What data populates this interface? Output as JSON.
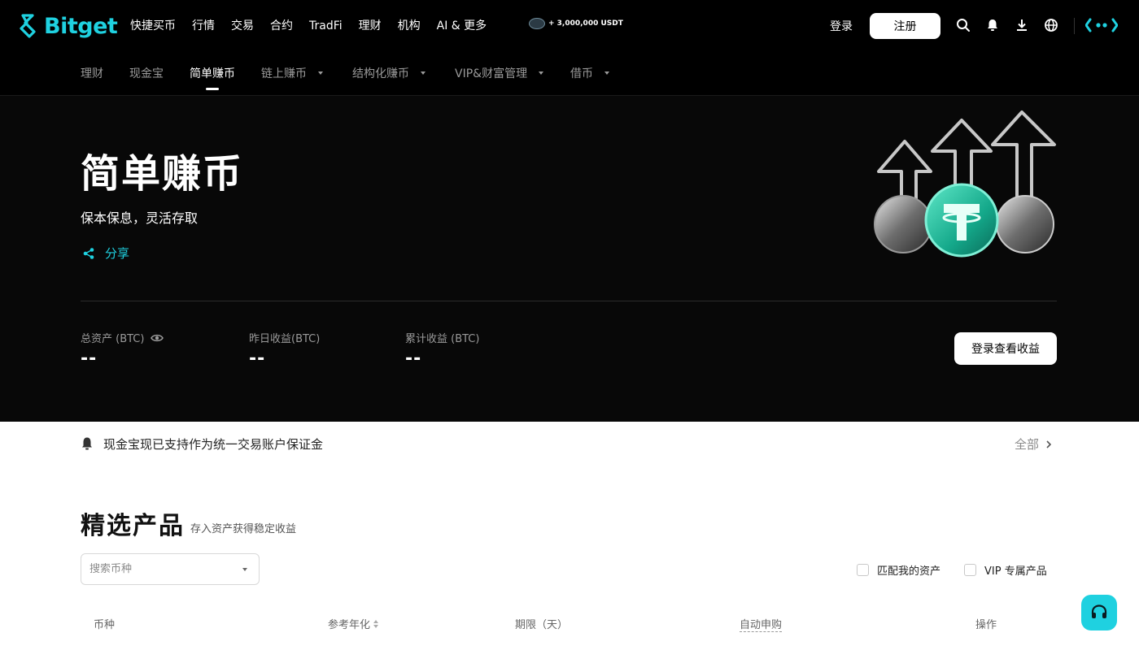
{
  "brand": {
    "name": "Bitget",
    "accent": "#1fd1e0"
  },
  "topnav": {
    "menu": [
      "快捷买币",
      "行情",
      "交易",
      "合约",
      "TradFi",
      "理财",
      "机构",
      "AI & 更多"
    ],
    "promo_text": "+ 3,000,000 USDT",
    "login_label": "登录",
    "register_label": "注册",
    "icons": [
      "search-icon",
      "bell-icon",
      "download-icon",
      "globe-icon",
      "more-icon"
    ]
  },
  "subnav": {
    "items": [
      {
        "label": "理财",
        "active": false,
        "dropdown": false
      },
      {
        "label": "现金宝",
        "active": false,
        "dropdown": false
      },
      {
        "label": "简单赚币",
        "active": true,
        "dropdown": false
      },
      {
        "label": "链上赚币",
        "active": false,
        "dropdown": true
      },
      {
        "label": "结构化赚币",
        "active": false,
        "dropdown": true
      },
      {
        "label": "VIP&财富管理",
        "active": false,
        "dropdown": true
      },
      {
        "label": "借币",
        "active": false,
        "dropdown": true
      }
    ]
  },
  "hero": {
    "title": "简单赚币",
    "subtitle": "保本保息，灵活存取",
    "share_label": "分享",
    "stats": [
      {
        "label": "总资产 (BTC)",
        "value": "--"
      },
      {
        "label": "昨日收益(BTC)",
        "value": "--"
      },
      {
        "label": "累计收益 (BTC)",
        "value": "--"
      }
    ],
    "view_button_label": "登录查看收益"
  },
  "notice": {
    "text": "现金宝现已支持作为统一交易账户保证金",
    "all_label": "全部"
  },
  "products": {
    "title": "精选产品",
    "subtitle": "存入资产获得稳定收益",
    "search_placeholder": "搜索币种",
    "filters": [
      "匹配我的资产",
      "VIP 专属产品"
    ],
    "columns": [
      "币种",
      "参考年化",
      "期限（天）",
      "自动申购",
      "操作"
    ]
  }
}
